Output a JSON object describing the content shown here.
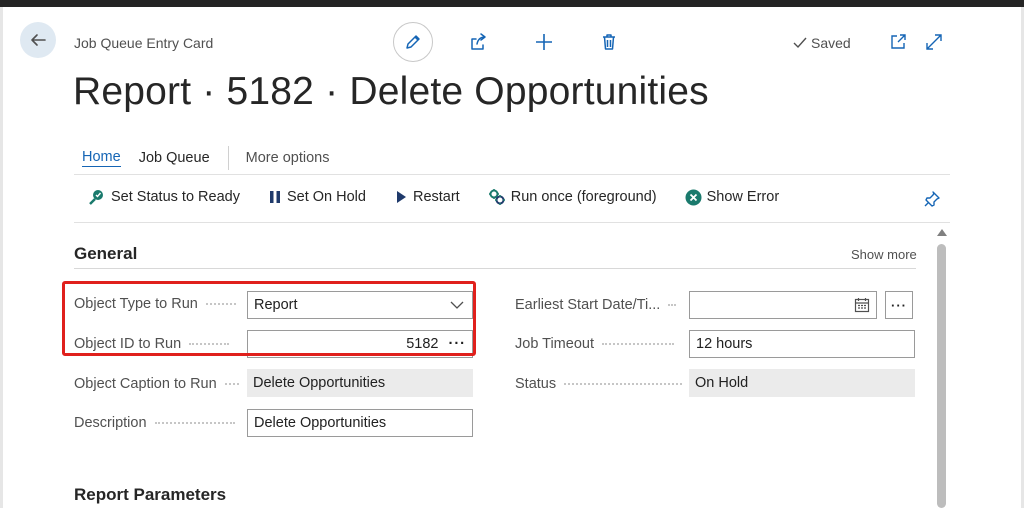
{
  "header": {
    "breadcrumb": "Job Queue Entry Card",
    "saved_label": "Saved",
    "title": "Report · 5182 · Delete Opportunities"
  },
  "tabs": [
    {
      "label": "Home",
      "active": true
    },
    {
      "label": "Job Queue",
      "active": false
    },
    {
      "label": "More options",
      "active": false
    }
  ],
  "actions": [
    {
      "label": "Set Status to Ready",
      "icon": "set-status-icon"
    },
    {
      "label": "Set On Hold",
      "icon": "pause-icon"
    },
    {
      "label": "Restart",
      "icon": "play-icon"
    },
    {
      "label": "Run once (foreground)",
      "icon": "run-once-icon"
    },
    {
      "label": "Show Error",
      "icon": "error-icon"
    }
  ],
  "general": {
    "section_title": "General",
    "show_more": "Show more",
    "fields": {
      "object_type": {
        "label": "Object Type to Run",
        "value": "Report"
      },
      "object_id": {
        "label": "Object ID to Run",
        "value": "5182",
        "assist": "···"
      },
      "object_caption": {
        "label": "Object Caption to Run",
        "value": "Delete Opportunities"
      },
      "description": {
        "label": "Description",
        "value": "Delete Opportunities"
      },
      "earliest_start": {
        "label": "Earliest Start Date/Ti...",
        "value": "",
        "assist": "···"
      },
      "job_timeout": {
        "label": "Job Timeout",
        "value": "12 hours"
      },
      "status": {
        "label": "Status",
        "value": "On Hold"
      }
    }
  },
  "report_parameters": {
    "section_title": "Report Parameters"
  },
  "colors": {
    "accent": "#1565b5",
    "highlight": "#e0201c",
    "readonly_bg": "#ebebeb"
  }
}
